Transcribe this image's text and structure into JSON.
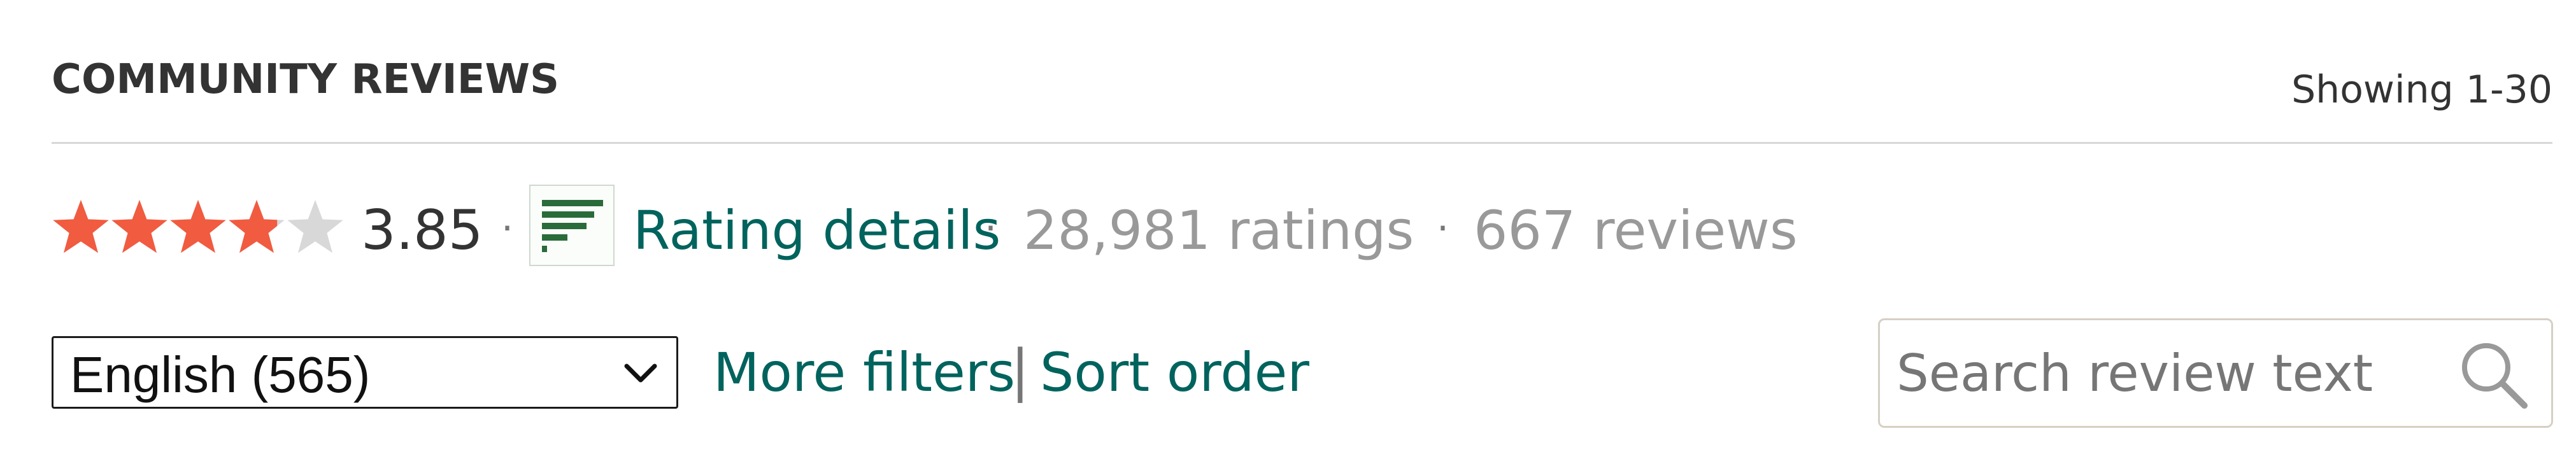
{
  "header": {
    "title": "COMMUNITY REVIEWS",
    "showing": "Showing 1-30"
  },
  "rating": {
    "average": "3.85",
    "stars_value": 3.85,
    "stars_max": 5,
    "star_color": "#f15b40",
    "star_empty_color": "#d8d8d8",
    "separator": "·",
    "details_icon": "histogram-icon",
    "details_label": "Rating details",
    "ratings_count": "28,981 ratings",
    "reviews_count": "667 reviews"
  },
  "filters": {
    "language_selected": "English (565)",
    "more_filters_label": "More filters",
    "separator": "|",
    "sort_order_label": "Sort order",
    "search_placeholder": "Search review text",
    "search_icon": "search-icon",
    "link_color": "#00635d"
  }
}
